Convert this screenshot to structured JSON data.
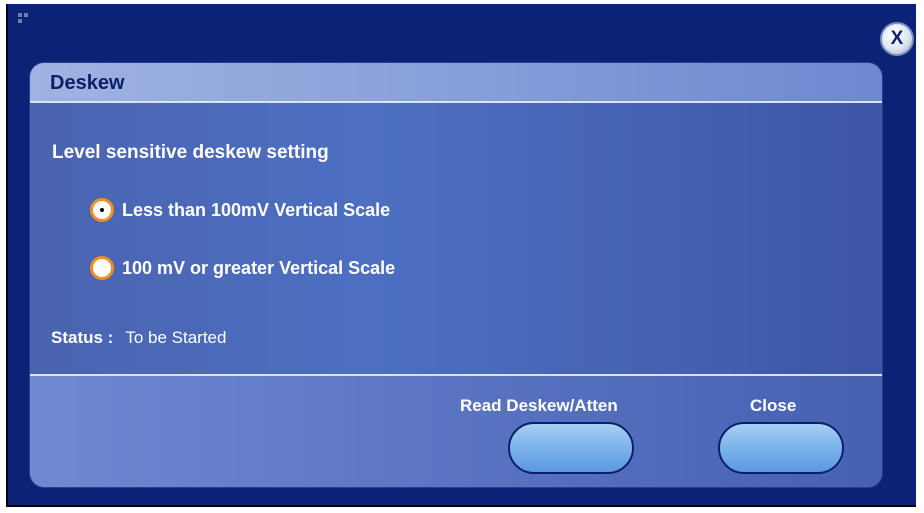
{
  "dialog": {
    "title": "Deskew",
    "setting_label": "Level sensitive deskew setting",
    "options": [
      {
        "label": "Less than 100mV Vertical Scale",
        "selected": true
      },
      {
        "label": "100 mV or greater Vertical Scale",
        "selected": false
      }
    ],
    "status_label": "Status :",
    "status_value": "To be Started",
    "buttons": {
      "read": "Read Deskew/Atten",
      "close": "Close"
    },
    "close_icon_glyph": "X"
  },
  "colors": {
    "window_bg": "#0c2276",
    "panel": "#4d6fc2",
    "radio_ring": "#f0901c",
    "button": "#7fb5ec"
  }
}
